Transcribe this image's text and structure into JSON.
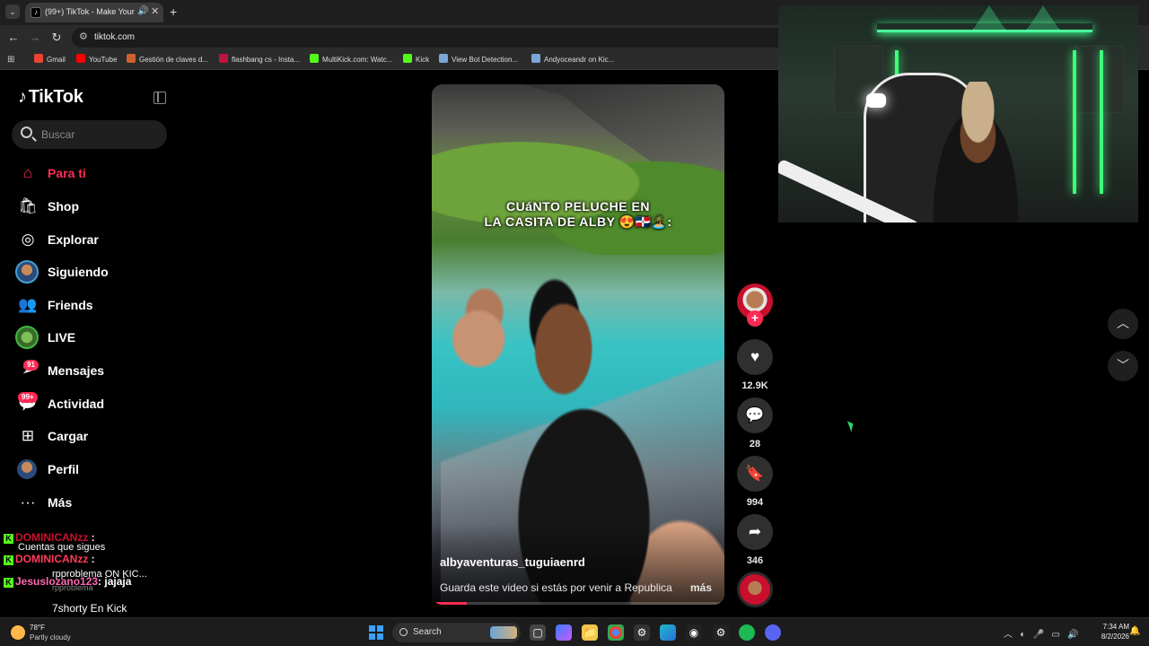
{
  "browser": {
    "tab_title": "(99+) TikTok - Make Your Day",
    "url": "tiktok.com",
    "bookmarks": [
      {
        "label": "Gmail",
        "color": "#ea4335"
      },
      {
        "label": "YouTube",
        "color": "#ff0000"
      },
      {
        "label": "Gestión de claves d...",
        "color": "#d06030"
      },
      {
        "label": "flashbang cs - Insta...",
        "color": "#c0143c"
      },
      {
        "label": "MultiKick.com: Watc...",
        "color": "#53fc18"
      },
      {
        "label": "Kick",
        "color": "#53fc18"
      },
      {
        "label": "View Bot Detection...",
        "color": "#7aa7d8"
      },
      {
        "label": "Andyoceandr on Kic...",
        "color": "#7aa7d8"
      }
    ]
  },
  "sidebar": {
    "logo": "TikTok",
    "search_placeholder": "Buscar",
    "items": [
      {
        "label": "Para ti",
        "icon": "home-icon"
      },
      {
        "label": "Shop",
        "icon": "shop-bag-icon"
      },
      {
        "label": "Explorar",
        "icon": "compass-icon"
      },
      {
        "label": "Siguiendo",
        "icon": "avatar"
      },
      {
        "label": "Friends",
        "icon": "friends-icon"
      },
      {
        "label": "LIVE",
        "icon": "live-avatar"
      },
      {
        "label": "Mensajes",
        "icon": "send-icon",
        "badge": "91"
      },
      {
        "label": "Actividad",
        "icon": "message-icon",
        "badge": "99+"
      },
      {
        "label": "Cargar",
        "icon": "upload-icon"
      },
      {
        "label": "Perfil",
        "icon": "avatar"
      },
      {
        "label": "Más",
        "icon": "more-icon"
      }
    ],
    "following_section": "Cuentas que sigues"
  },
  "chat": [
    {
      "user": "DOMINICANzz",
      "msg": ":",
      "color": "#c8102e"
    },
    {
      "user": "DOMINICANzz",
      "msg": ":",
      "color": "#ff3b5c"
    },
    {
      "user": "Jesuslozano123",
      "msg": ": jajaja",
      "color": "#ff69b4"
    },
    {
      "user": "rpproblema ON KIC...",
      "msg": "",
      "color": "#eee"
    },
    {
      "user": "rpproblema",
      "msg": "",
      "color": "#aaa"
    },
    {
      "user": "7shorty En Kick",
      "msg": "",
      "color": "#fff"
    }
  ],
  "video": {
    "overlay_text_line1": "CUáNTO PELUCHE EN",
    "overlay_text_line2": "LA CASITA DE ALBY 😍🇩🇴🏝️:",
    "username": "albyaventuras_tuguiaenrd",
    "description": "Guarda este video si estás por venir a Republica",
    "more": "más",
    "progress": 0.12
  },
  "actions": {
    "likes": "12.9K",
    "comments": "28",
    "saves": "994",
    "shares": "346"
  },
  "taskbar": {
    "temp": "78°F",
    "condition": "Partly cloudy",
    "search": "Search",
    "time": "7:34 AM",
    "date": "8/2/2026"
  }
}
